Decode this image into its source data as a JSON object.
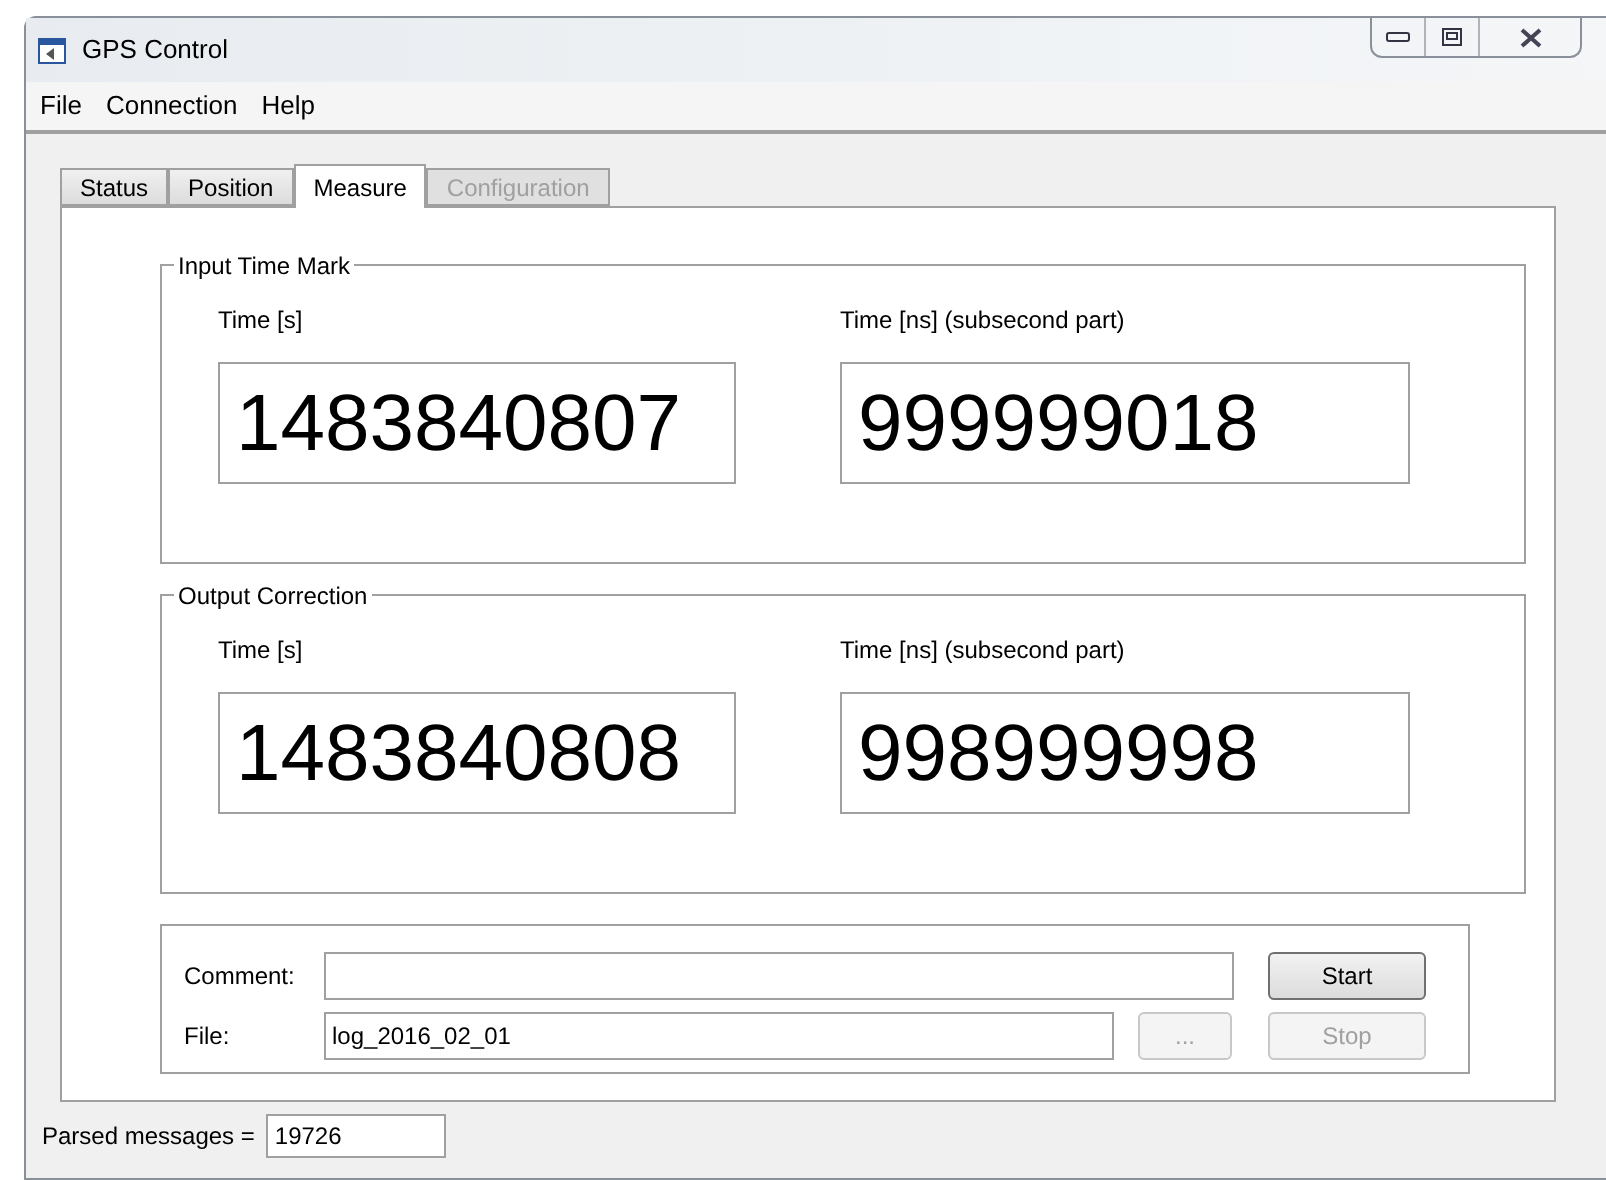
{
  "window": {
    "title": "GPS Control"
  },
  "menu": [
    "File",
    "Connection",
    "Help"
  ],
  "tabs": [
    {
      "label": "Status",
      "selected": false,
      "disabled": false
    },
    {
      "label": "Position",
      "selected": false,
      "disabled": false
    },
    {
      "label": "Measure",
      "selected": true,
      "disabled": false
    },
    {
      "label": "Configuration",
      "selected": false,
      "disabled": true
    }
  ],
  "groups": [
    {
      "title": "Input Time Mark",
      "fields": [
        {
          "label": "Time [s]",
          "value": "1483840807"
        },
        {
          "label": "Time [ns] (subsecond part)",
          "value": "999999018"
        }
      ]
    },
    {
      "title": "Output Correction",
      "fields": [
        {
          "label": "Time [s]",
          "value": "1483840808"
        },
        {
          "label": "Time [ns] (subsecond part)",
          "value": "998999998"
        }
      ]
    }
  ],
  "logging": {
    "comment_label": "Comment:",
    "file_label": "File:",
    "file_value": "log_2016_02_01",
    "browse_button": {
      "label": "...",
      "disabled": true
    },
    "start_button": {
      "label": "Start",
      "disabled": false
    },
    "stop_button": {
      "label": "Stop",
      "disabled": true
    }
  },
  "status": {
    "label": "Parsed messages =",
    "value": "19726"
  }
}
